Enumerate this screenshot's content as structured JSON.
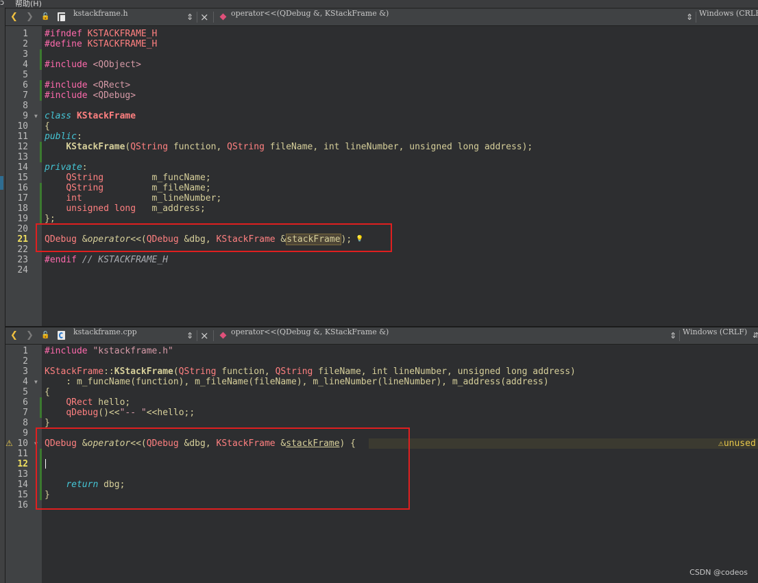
{
  "menu": {
    "item_prev": "ɔ",
    "item_help": "帮助(H)"
  },
  "top": {
    "nav_back": "❮",
    "nav_forward": "❯",
    "lock": "🔓",
    "file_name": "kstackframe.h",
    "file_switch": "⇕",
    "close": "×",
    "symbol": "operator<<(QDebug &, KStackFrame &)",
    "encoding": "Windows (CRLF)",
    "encoding_switch": "⇕",
    "line_numbers": [
      "1",
      "2",
      "3",
      "4",
      "5",
      "6",
      "7",
      "8",
      "9",
      "10",
      "11",
      "12",
      "13",
      "14",
      "15",
      "16",
      "17",
      "18",
      "19",
      "20",
      "21",
      "22",
      "23",
      "24"
    ],
    "current_line": "21",
    "bulb": "💡"
  },
  "bottom": {
    "nav_back": "❮",
    "nav_forward": "❯",
    "lock": "🔓",
    "file_name": "kstackframe.cpp",
    "file_switch": "⇕",
    "close": "×",
    "symbol": "operator<<(QDebug &, KStackFrame &)",
    "encoding": "Windows (CRLF)",
    "encoding_switch": "⇕",
    "overflow": "⇵",
    "line_numbers": [
      "1",
      "2",
      "3",
      "4",
      "5",
      "6",
      "7",
      "8",
      "9",
      "10",
      "11",
      "12",
      "13",
      "14",
      "15",
      "16"
    ],
    "current_line": "12",
    "warning_icon": "⚠",
    "warning_text": "⚠unused"
  },
  "watermark": "CSDN @codeos",
  "colors": {
    "accent_red": "#e01f1f",
    "keyword": "#45c6d6",
    "preprocessor": "#ff6aad",
    "type": "#ff8080",
    "warning": "#e8c84a"
  }
}
